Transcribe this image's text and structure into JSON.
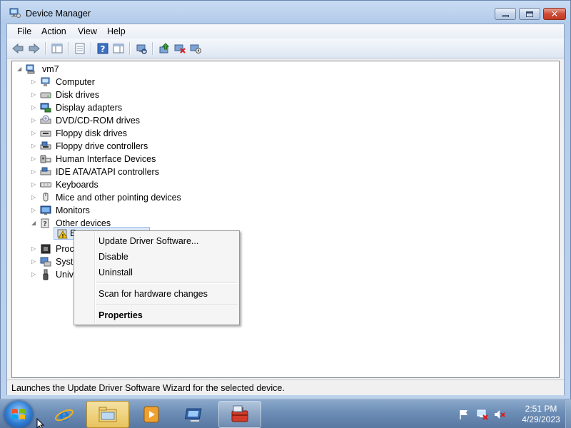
{
  "window": {
    "title": "Device Manager",
    "icon": "device-manager-icon"
  },
  "menubar": {
    "items": [
      "File",
      "Action",
      "View",
      "Help"
    ]
  },
  "toolbar": {
    "buttons": [
      "back-icon",
      "forward-icon",
      "show-hide-console-tree-icon",
      "properties-sheet-icon",
      "help-icon",
      "show-hide-action-pane-icon",
      "scan-hardware-icon",
      "update-driver-icon",
      "uninstall-icon",
      "disable-icon"
    ]
  },
  "tree": {
    "root": "vm7",
    "nodes": [
      {
        "label": "Computer",
        "icon": "computer-icon",
        "expanded": false
      },
      {
        "label": "Disk drives",
        "icon": "disk-drive-icon",
        "expanded": false
      },
      {
        "label": "Display adapters",
        "icon": "display-adapter-icon",
        "expanded": false
      },
      {
        "label": "DVD/CD-ROM drives",
        "icon": "dvd-drive-icon",
        "expanded": false
      },
      {
        "label": "Floppy disk drives",
        "icon": "floppy-drive-icon",
        "expanded": false
      },
      {
        "label": "Floppy drive controllers",
        "icon": "floppy-controller-icon",
        "expanded": false
      },
      {
        "label": "Human Interface Devices",
        "icon": "hid-icon",
        "expanded": false
      },
      {
        "label": "IDE ATA/ATAPI controllers",
        "icon": "ide-controller-icon",
        "expanded": false
      },
      {
        "label": "Keyboards",
        "icon": "keyboard-icon",
        "expanded": false
      },
      {
        "label": "Mice and other pointing devices",
        "icon": "mouse-icon",
        "expanded": false
      },
      {
        "label": "Monitors",
        "icon": "monitor-icon",
        "expanded": false
      },
      {
        "label": "Other devices",
        "icon": "other-devices-icon",
        "expanded": true
      },
      {
        "label": "Proce",
        "icon": "processor-icon",
        "expanded": false
      },
      {
        "label": "Syste",
        "icon": "system-devices-icon",
        "expanded": false
      },
      {
        "label": "Unive",
        "icon": "usb-icon",
        "expanded": false
      }
    ],
    "child_of_other_devices": {
      "label": "E",
      "icon": "warning-device-icon"
    }
  },
  "context_menu": {
    "items": [
      "Update Driver Software...",
      "Disable",
      "Uninstall",
      "Scan for hardware changes",
      "Properties"
    ]
  },
  "statusbar": {
    "text": "Launches the Update Driver Software Wizard for the selected device."
  },
  "taskbar": {
    "pinned": [
      "internet-explorer-icon",
      "windows-explorer-icon",
      "media-player-icon",
      "remote-desktop-icon",
      "device-manager-toolbox-icon"
    ],
    "clock": {
      "time": "2:51 PM",
      "date": "4/29/2023"
    },
    "tray": [
      "action-center-flag-icon",
      "network-icon",
      "volume-muted-icon"
    ]
  }
}
